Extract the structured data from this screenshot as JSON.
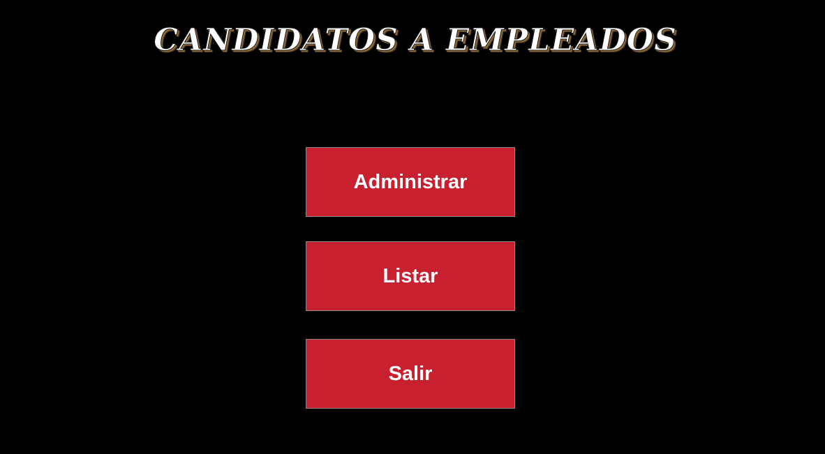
{
  "header": {
    "title": "CANDIDATOS A EMPLEADOS"
  },
  "menu": {
    "administrar_label": "Administrar",
    "listar_label": "Listar",
    "salir_label": "Salir"
  },
  "colors": {
    "background": "#000000",
    "button": "#c8202f",
    "text": "#ffffff"
  }
}
